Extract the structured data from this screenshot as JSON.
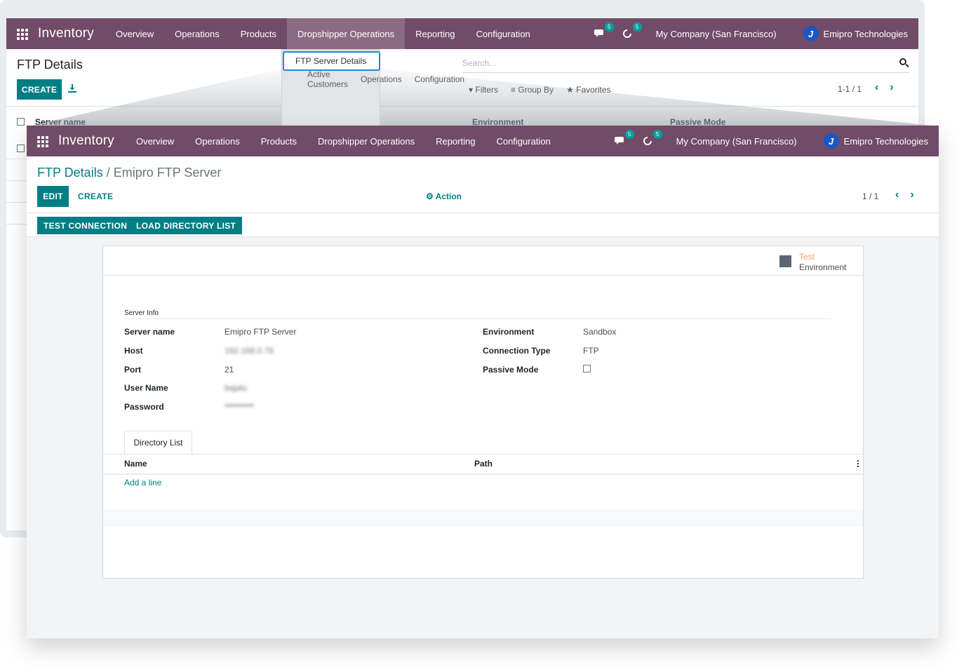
{
  "back": {
    "navbar": {
      "brand": "Inventory",
      "menu": [
        "Overview",
        "Operations",
        "Products",
        "Dropshipper Operations",
        "Reporting",
        "Configuration"
      ],
      "active_menu": "Dropshipper Operations",
      "messages_count": "5",
      "activities_count": "5",
      "company": "My Company (San Francisco)",
      "user": "Emipro Technologies"
    },
    "title": "FTP Details",
    "create_label": "CREATE",
    "search_placeholder": "Search...",
    "filters": "Filters",
    "group_by": "Group By",
    "favorites": "Favorites",
    "pager": "1-1 / 1",
    "columns": [
      "Server name",
      "Environment",
      "Passive Mode"
    ],
    "dropdown": {
      "selected": "FTP Server Details",
      "items": [
        "Active Customers",
        "Operations",
        "Configuration"
      ]
    }
  },
  "front": {
    "navbar": {
      "brand": "Inventory",
      "menu": [
        "Overview",
        "Operations",
        "Products",
        "Dropshipper Operations",
        "Reporting",
        "Configuration"
      ],
      "messages_count": "5",
      "activities_count": "5",
      "company": "My Company (San Francisco)",
      "user": "Emipro Technologies"
    },
    "breadcrumb_parent": "FTP Details",
    "breadcrumb_sep": " / ",
    "breadcrumb_current": "Emipro FTP Server",
    "edit_label": "EDIT",
    "create_label": "CREATE",
    "action_label": "Action",
    "pager": "1 / 1",
    "buttons": [
      "TEST CONNECTION",
      "LOAD DIRECTORY LIST"
    ],
    "env_ribbon": {
      "line1": "Test",
      "line2": "Environment",
      "color": "#5c6572"
    },
    "group_title": "Server Info",
    "fields_left": [
      {
        "label": "Server name",
        "value": "Emipro FTP Server"
      },
      {
        "label": "Host",
        "value": "192.168.0.76"
      },
      {
        "label": "Port",
        "value": "21"
      },
      {
        "label": "User Name",
        "value": "bajalu"
      },
      {
        "label": "Password",
        "value": "••••••••••"
      }
    ],
    "fields_right": [
      {
        "label": "Environment",
        "value": "Sandbox"
      },
      {
        "label": "Connection Type",
        "value": "FTP"
      },
      {
        "label": "Passive Mode",
        "value": "",
        "checked": false
      }
    ],
    "tab": "Directory List",
    "table_headers": [
      "Name",
      "Path"
    ],
    "add_line": "Add a line"
  },
  "colors": {
    "navbar": "#714b67",
    "primary": "#017e84",
    "badge": "#00a09d"
  }
}
